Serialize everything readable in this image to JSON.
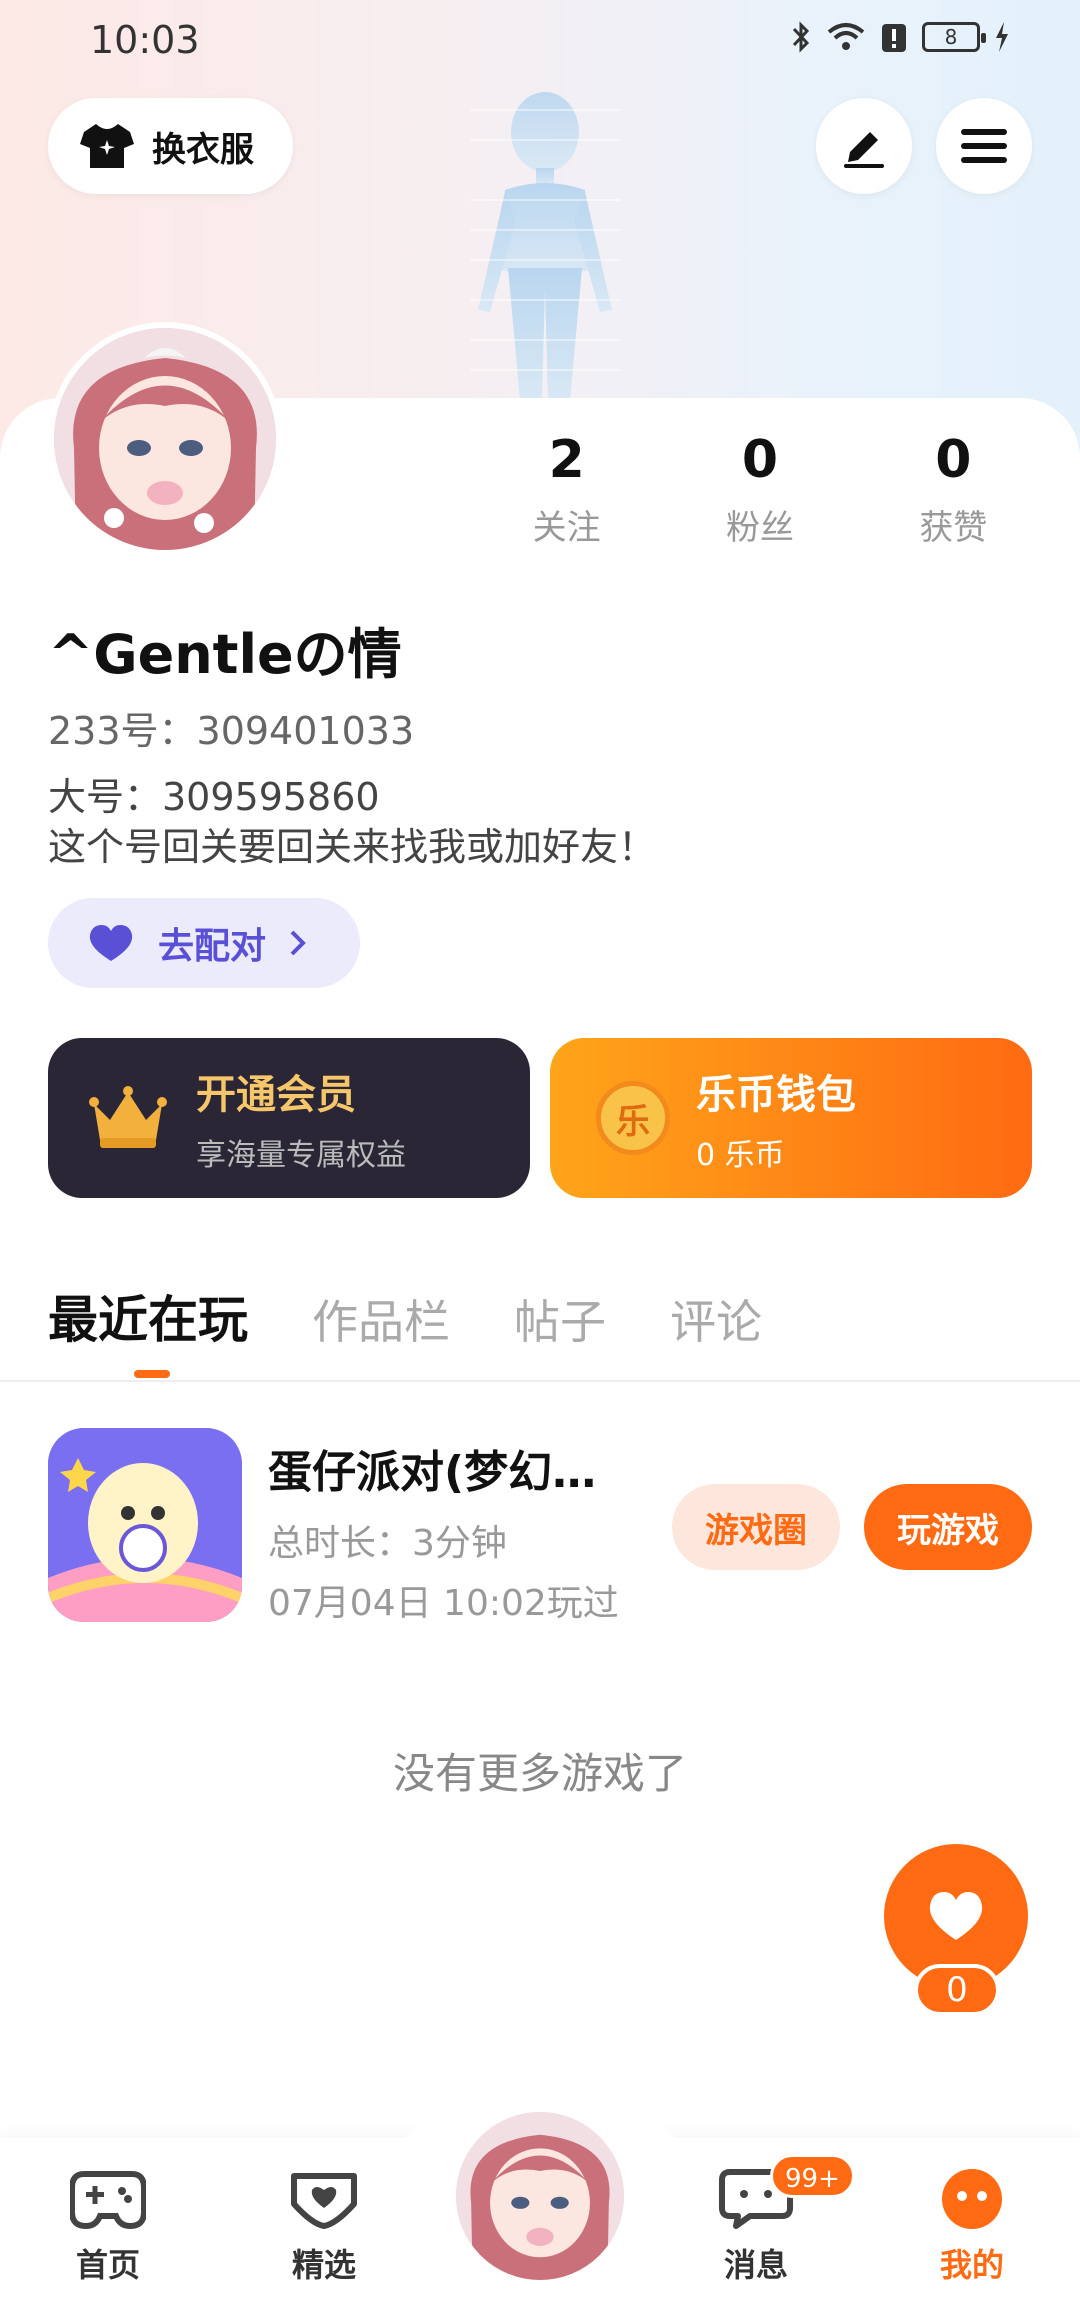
{
  "status_bar": {
    "time": "10:03",
    "battery": "8"
  },
  "header": {
    "outfit_label": "换衣服"
  },
  "profile": {
    "username": "^Gentleの情",
    "uid_line": "233号：309401033",
    "bio_lines": [
      "大号：309595860",
      "这个号回关要回关来找我或加好友！"
    ],
    "stats": [
      {
        "value": "2",
        "label": "关注"
      },
      {
        "value": "0",
        "label": "粉丝"
      },
      {
        "value": "0",
        "label": "获赞"
      }
    ],
    "match_label": "去配对"
  },
  "cards": {
    "vip": {
      "title": "开通会员",
      "subtitle": "享海量专属权益"
    },
    "coin": {
      "title": "乐币钱包",
      "subtitle": "0 乐币",
      "icon_char": "乐"
    }
  },
  "tabs": [
    "最近在玩",
    "作品栏",
    "帖子",
    "评论"
  ],
  "games": [
    {
      "title": "蛋仔派对(梦幻…",
      "duration": "总时长：3分钟",
      "last_played": "07月04日 10:02玩过",
      "circle_label": "游戏圈",
      "play_label": "玩游戏"
    }
  ],
  "empty_text": "没有更多游戏了",
  "like": {
    "count": "0"
  },
  "nav": {
    "items": [
      "首页",
      "精选",
      "消息",
      "我的"
    ],
    "message_badge": "99+"
  },
  "colors": {
    "accent": "#ff6a12",
    "vip_bg": "#2a2636",
    "match_purple": "#5a50d6"
  }
}
